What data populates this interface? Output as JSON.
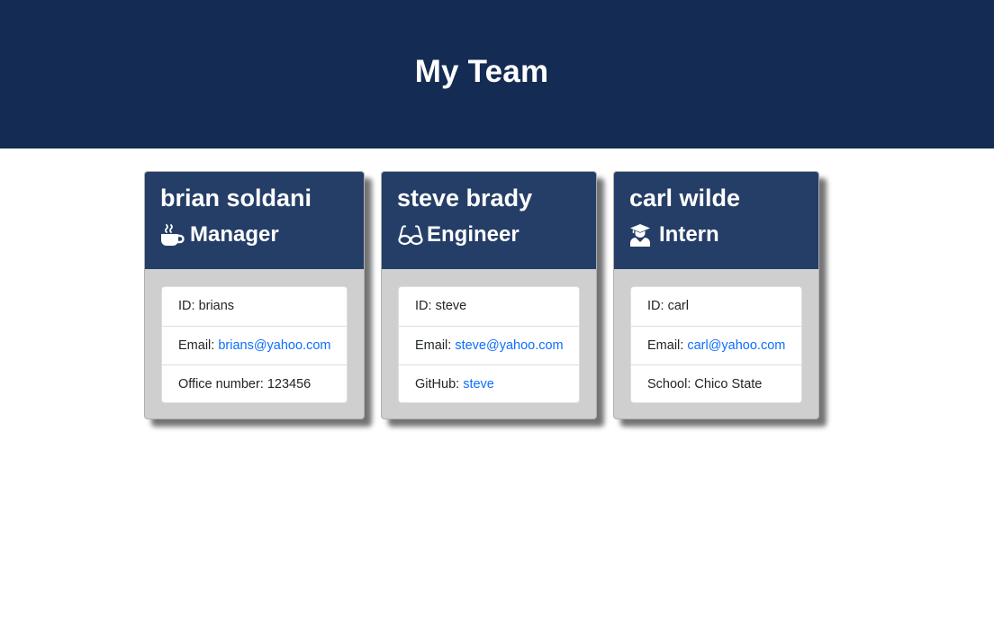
{
  "header": {
    "title": "My Team",
    "background": "#142b54"
  },
  "colors": {
    "card_header": "#253e67",
    "card_body": "#cfcfcf",
    "link": "#0d6efd"
  },
  "team": [
    {
      "name": "brian soldani",
      "role": "Manager",
      "role_icon": "coffee-mug-icon",
      "id_label": "ID: ",
      "id": "brians",
      "email_label": "Email: ",
      "email": "brians@yahoo.com",
      "extra_label": "Office number: ",
      "extra_value": "123456"
    },
    {
      "name": "steve brady",
      "role": "Engineer",
      "role_icon": "glasses-icon",
      "id_label": "ID: ",
      "id": "steve",
      "email_label": "Email: ",
      "email": "steve@yahoo.com",
      "extra_label": "GitHub: ",
      "extra_value": "steve"
    },
    {
      "name": "carl wilde",
      "role": "Intern",
      "role_icon": "graduate-icon",
      "id_label": "ID: ",
      "id": "carl",
      "email_label": "Email: ",
      "email": "carl@yahoo.com",
      "extra_label": "School: ",
      "extra_value": "Chico State"
    }
  ]
}
